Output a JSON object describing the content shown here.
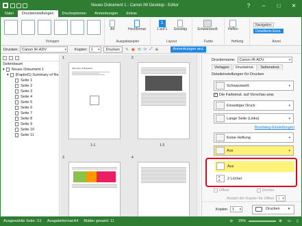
{
  "window": {
    "title": "Neues Dokument 1 - Canon iW Desktop - Editor"
  },
  "tabs": [
    "Datei",
    "Druckeinstellungen",
    "Druckoptionen",
    "Anmerkungen",
    "Extras"
  ],
  "active_tab": "Druckeinstellungen",
  "ribbon": {
    "groups": [
      "Vorlagen",
      "Ausgabepapier",
      "Layout",
      "Farbe",
      "Heftung",
      "Anzei"
    ],
    "a4_label": "A4",
    "orientation_label": "Hochformat",
    "layout_label": "1 auf 1",
    "sides_label": "Einseitig",
    "color_label": "Schwarzweiß",
    "staple_label": "Heften",
    "navigation_label": "Navigation",
    "detail_label": "Detaillierte Einst."
  },
  "toolbar": {
    "printer_label": "Drucken:",
    "printer_value": "Canon iR-ADV",
    "copies_label": "Kopien:",
    "copies_value": "1",
    "print_button": "Drucken",
    "annotations_button": "Anmerkungen anz."
  },
  "left_panel": {
    "title": "Seitenbaum",
    "root": "Neues Dokument 1",
    "chapter": "[Kapitel1] Summary of Re",
    "pages": [
      "Seite 1",
      "Seite 2",
      "Seite 3",
      "Seite 4",
      "Seite 5",
      "Seite 6",
      "Seite 7",
      "Seite 8",
      "Seite 9",
      "Seite 10",
      "Seite 11"
    ]
  },
  "preview": {
    "page_numbers": [
      "1",
      "2",
      "3",
      "4"
    ],
    "spread_labels": [
      "1-1",
      "1-2"
    ],
    "page1_heading": "Summary of Research"
  },
  "right_panel": {
    "printer_name_label": "Druckername:",
    "printer_name_value": "Canon iR-ADV",
    "tabs": [
      "Vorlagen",
      "Druckeinst.",
      "Seiteneinst."
    ],
    "active_tab": "Druckeinst.",
    "detail_header": "Detaileinstellungen für Drucken",
    "color_mode": "Schwarzweiß",
    "preview_checkbox": "Die Farbeinst. auf Vorschau anw.",
    "duplex": "Einseitiger Druck",
    "binding": "Lange Seite (Links)",
    "binding_link": "Bundsteg-Einstellungen",
    "staple": "Keine Heftung",
    "punch_selected": "Aus",
    "dropdown_options": [
      "Aus",
      "2 Löcher"
    ],
    "offset_label": "Offset",
    "offset_right": "Drehen",
    "offset_copies_label": "Anzahl der Kopien für Offset",
    "offset_copies_value": "1",
    "copies_label": "Kopien",
    "copies_value": "1",
    "print_button": "Drucken"
  },
  "status": {
    "selected": "Ausgewählte Seite: /11",
    "format": "Ausgabeformat:A4",
    "sheets": "Blätter gesamt: 11",
    "zoom": "25%"
  },
  "colors": {
    "brand": "#2e7d32",
    "highlight": "#fff27a",
    "callout": "#e0001b",
    "accent_blue": "#1e88e5"
  }
}
